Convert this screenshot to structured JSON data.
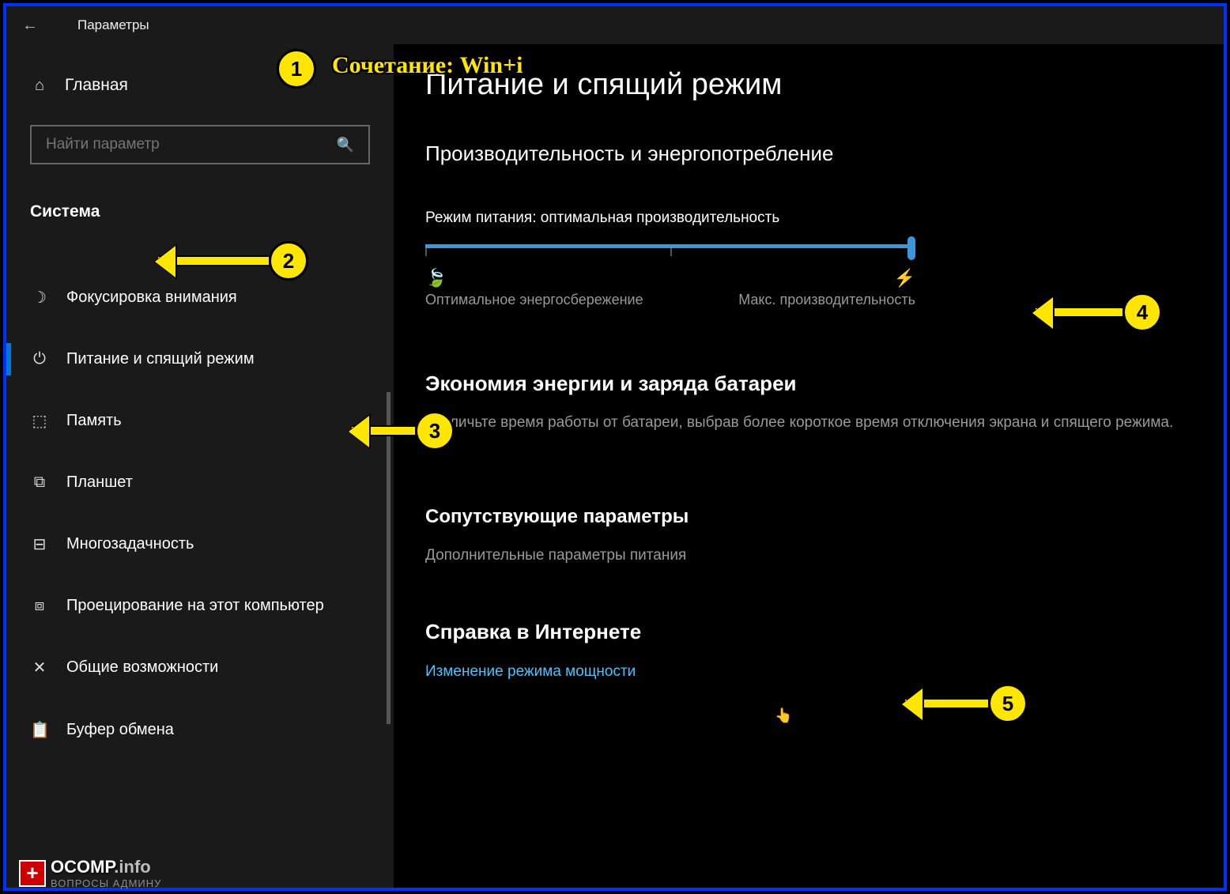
{
  "window": {
    "title": "Параметры"
  },
  "sidebar": {
    "home": "Главная",
    "search_placeholder": "Найти параметр",
    "category": "Система",
    "items": [
      {
        "label": "Фокусировка внимания"
      },
      {
        "label": "Питание и спящий режим"
      },
      {
        "label": "Память"
      },
      {
        "label": "Планшет"
      },
      {
        "label": "Многозадачность"
      },
      {
        "label": "Проецирование на этот компьютер"
      },
      {
        "label": "Общие возможности"
      },
      {
        "label": "Буфер обмена"
      }
    ]
  },
  "content": {
    "title": "Питание и спящий режим",
    "perf_heading": "Производительность и энергопотребление",
    "power_mode": "Режим питания: оптимальная производительность",
    "slider_left": "Оптимальное энергосбережение",
    "slider_right": "Макс. производительность",
    "battery_heading": "Экономия энергии и заряда батареи",
    "battery_desc": "Увеличьте время работы от батареи, выбрав более короткое время отключения экрана и спящего режима.",
    "related_heading": "Сопутствующие параметры",
    "related_link": "Дополнительные параметры питания",
    "help_heading": "Справка в Интернете",
    "help_link": "Изменение режима мощности"
  },
  "annotations": {
    "a1_text": "Сочетание: Win+i",
    "b1": "1",
    "b2": "2",
    "b3": "3",
    "b4": "4",
    "b5": "5"
  },
  "watermark": {
    "brand": "OCOMP",
    "tld": ".info",
    "sub": "ВОПРОСЫ АДМИНУ"
  }
}
